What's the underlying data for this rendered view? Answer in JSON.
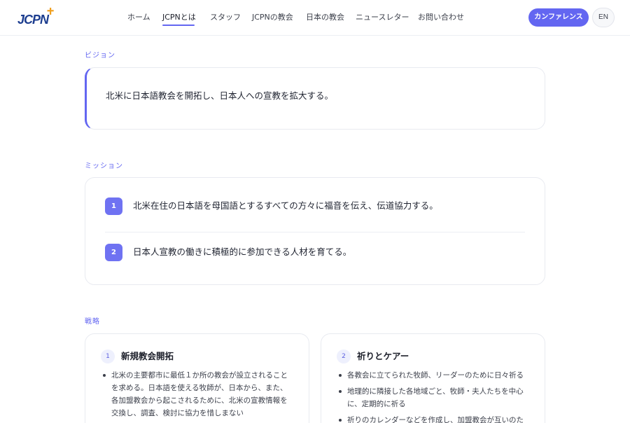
{
  "header": {
    "logo_text": "JCPN",
    "nav": [
      "ホーム",
      "JCPNとは",
      "スタッフ",
      "JCPNの教会",
      "日本の教会",
      "ニュースレター",
      "お問い合わせ"
    ],
    "active_nav": "JCPNとは",
    "conference_label": "カンファレンス",
    "lang_label": "EN"
  },
  "vision": {
    "label": "ビジョン",
    "text": "北米に日本語教会を開拓し、日本人への宣教を拡大する。"
  },
  "mission": {
    "label": "ミッション",
    "items": [
      {
        "num": "1",
        "text": "北米在住の日本語を母国語とするすべての方々に福音を伝え、伝道協力する。"
      },
      {
        "num": "2",
        "text": "日本人宣教の働きに積極的に参加できる人材を育てる。"
      }
    ]
  },
  "strategy": {
    "label": "戦略",
    "cards": [
      {
        "num": "1",
        "title": "新規教会開拓",
        "items": [
          "北米の主要都市に最低１か所の教会が設立されることを求める。日本語を使える牧師が、日本から、また、各加盟教会から起こされるために、北米の宣教情報を交換し、調査、検討に協力を惜しまない"
        ]
      },
      {
        "num": "2",
        "title": "祈りとケアー",
        "items": [
          "各教会に立てられた牧師、リーダーのために日々祈る",
          "地理的に隣接した各地域ごと、牧師・夫人たちを中心に、定期的に祈る",
          "祈りのカレンダーなどを作成し、加盟教会が互いのた"
        ]
      }
    ]
  },
  "colors": {
    "accent": "#6366f1",
    "text": "#1f2330",
    "logo_cross": "#f0a020",
    "logo_text": "#1c3d8f"
  }
}
